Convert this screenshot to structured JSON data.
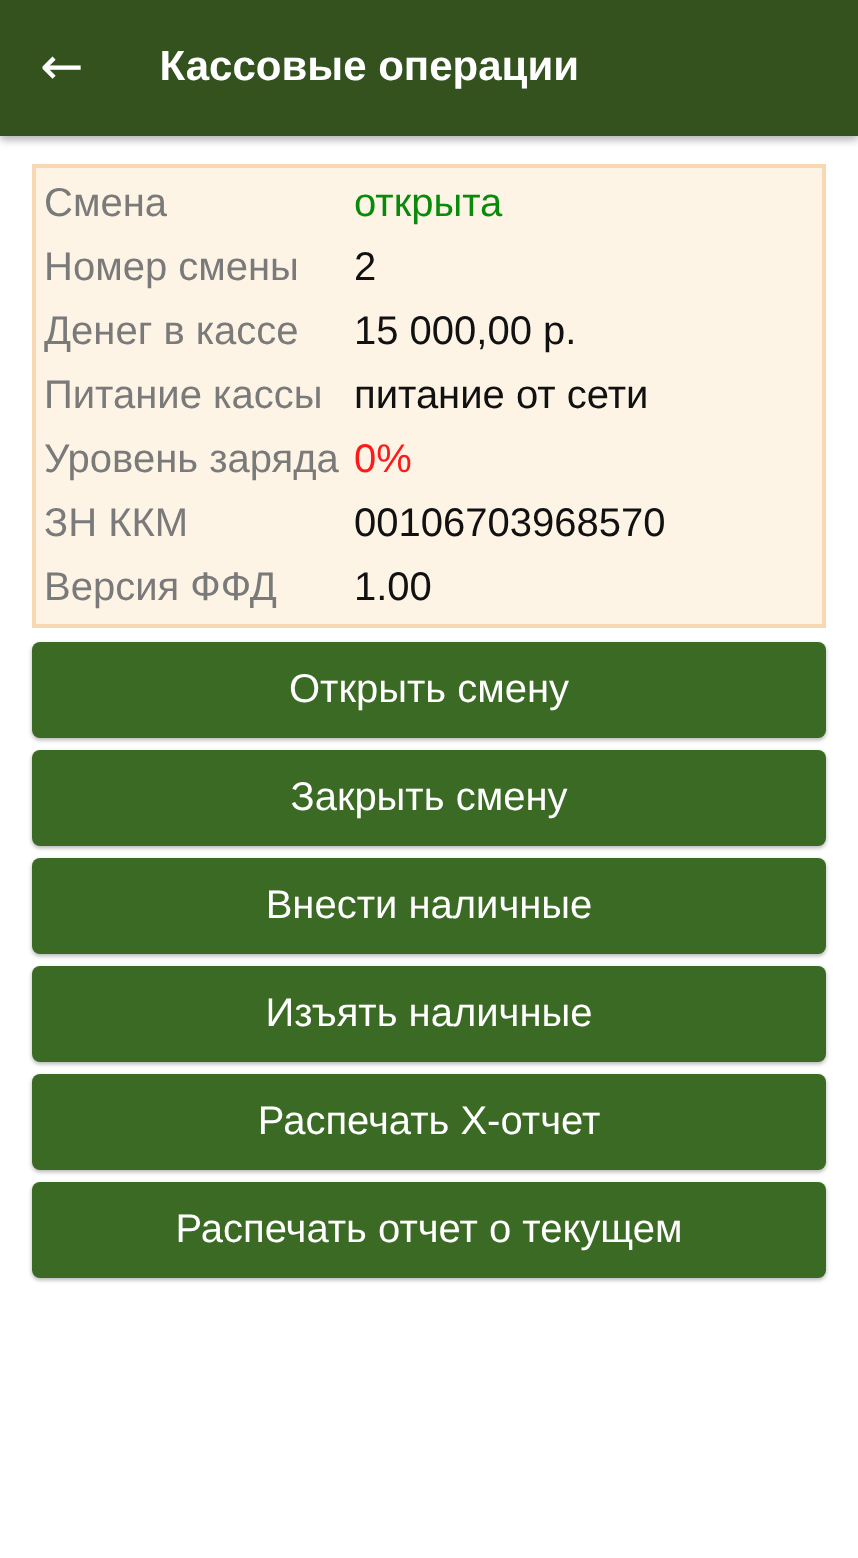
{
  "app_bar": {
    "back_icon": "←",
    "title": "Кассовые операции"
  },
  "info": [
    {
      "label": "Смена",
      "value": "открыта",
      "color": "#0a8a0a"
    },
    {
      "label": "Номер смены",
      "value": "2"
    },
    {
      "label": "Денег в кассе",
      "value": "15 000,00 р."
    },
    {
      "label": "Питание кассы",
      "value": "питание от сети"
    },
    {
      "label": "Уровень заряда",
      "value": "0%",
      "color": "#ff1a1a"
    },
    {
      "label": "ЗН ККМ",
      "value": "00106703968570"
    },
    {
      "label": "Версия ФФД",
      "value": "1.00"
    }
  ],
  "buttons": [
    "Открыть смену",
    "Закрыть смену",
    "Внести наличные",
    "Изъять наличные",
    "Распечать X-отчет",
    "Распечать отчет о текущем"
  ]
}
